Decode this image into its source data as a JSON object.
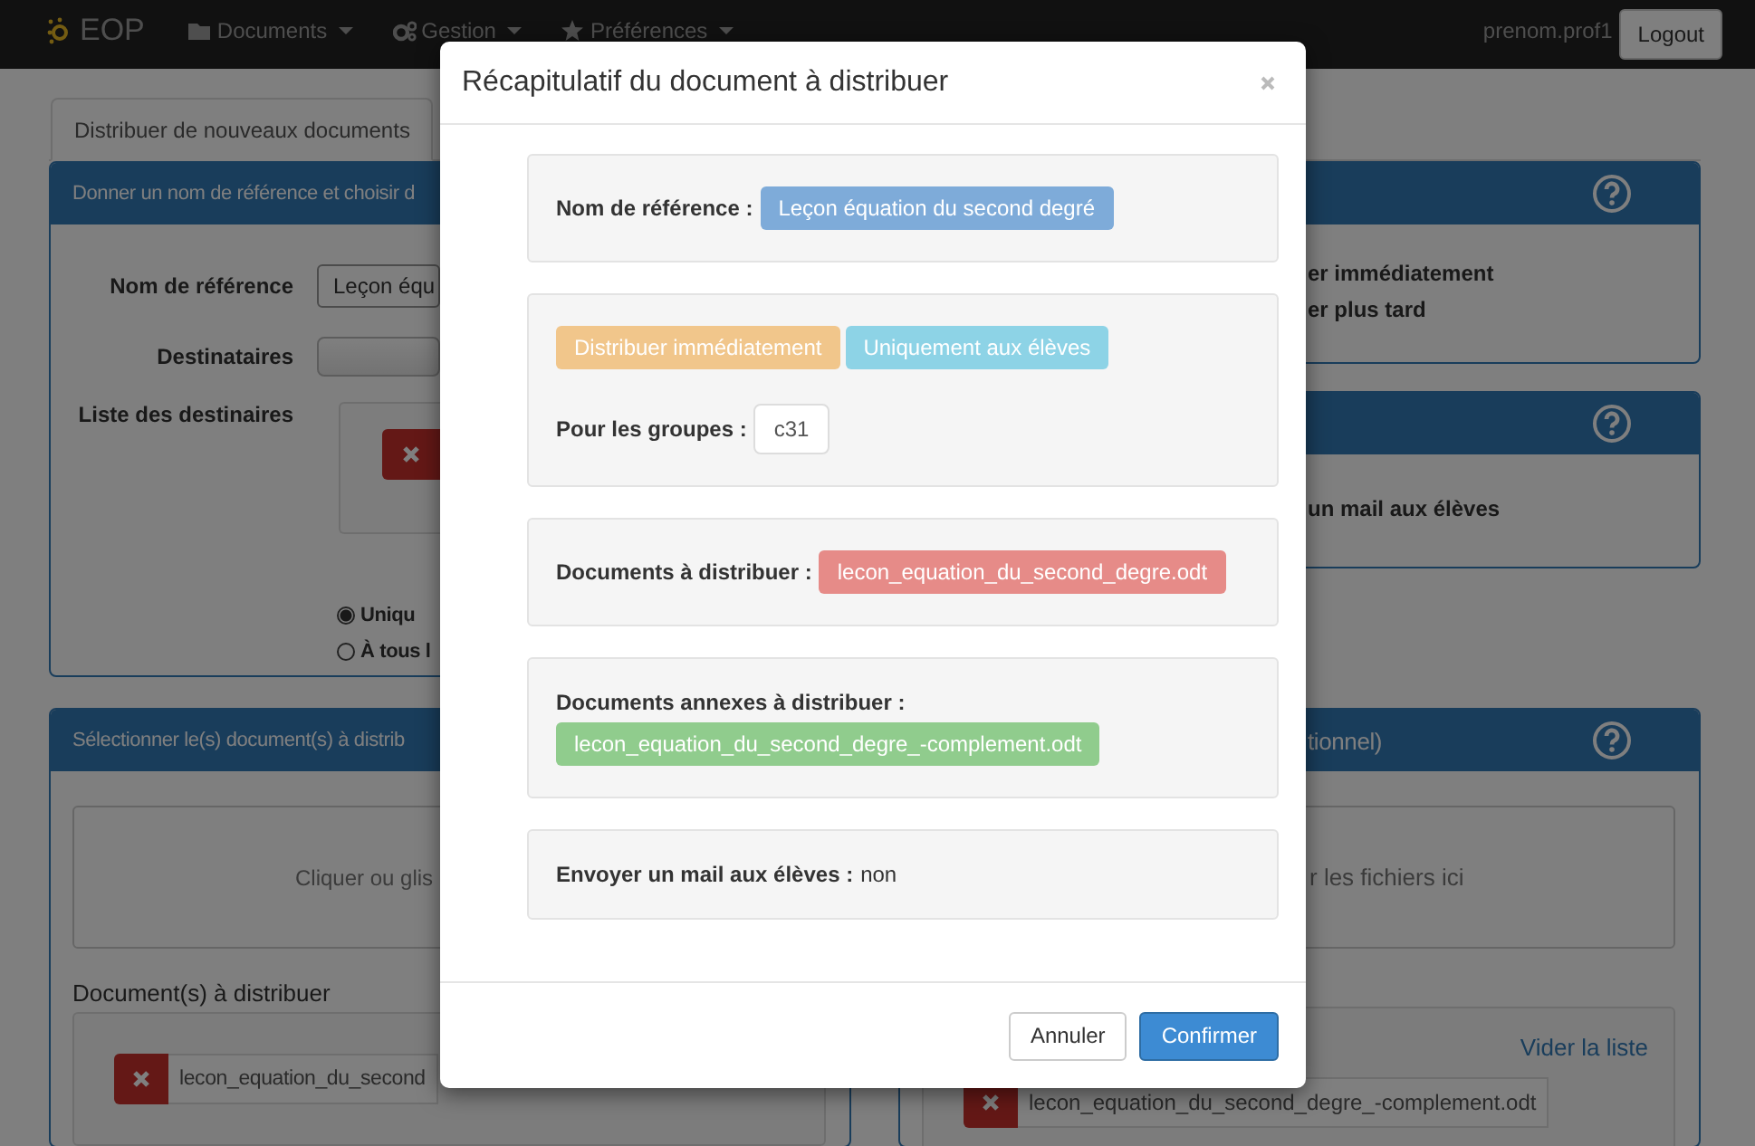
{
  "navbar": {
    "brand": "EOP",
    "menus": [
      {
        "label": "Documents"
      },
      {
        "label": "Gestion"
      },
      {
        "label": "Préférences"
      }
    ],
    "user": "prenom.prof1",
    "logout": "Logout"
  },
  "tabs": [
    {
      "label": "Distribuer de nouveaux documents",
      "selected": true
    }
  ],
  "name_panel": {
    "title": "Donner un nom de référence et choisir d",
    "reference_label": "Nom de référence",
    "reference_value": "Leçon équ",
    "recipients_label": "Destinataires",
    "recipient_list_label": "Liste des destinaires",
    "options": [
      {
        "label": "Uniqu",
        "selected": true
      },
      {
        "label": "À tous l",
        "selected": false
      }
    ]
  },
  "timing_panel": {
    "options": [
      "er immédiatement",
      "er plus tard"
    ]
  },
  "mail_panel": {
    "option": "un mail aux élèves"
  },
  "documents_panel": {
    "title": "Sélectionner le(s) document(s) à distrib",
    "dropzone": "Cliquer ou glis",
    "list_title": "Document(s) à distribuer",
    "files": [
      "lecon_equation_du_second"
    ]
  },
  "annex_panel": {
    "title": "tionnel)",
    "dropzone": "r les fichiers ici",
    "clear_link": "Vider la liste",
    "files": [
      "lecon_equation_du_second_degre_-complement.odt"
    ]
  },
  "modal": {
    "title": "Récapitulatif du document à distribuer",
    "reference": {
      "label": "Nom de référence :",
      "value": "Leçon équation du second degré"
    },
    "distribution": {
      "mode": "Distribuer immédiatement",
      "audience": "Uniquement aux élèves",
      "groups_label": "Pour les groupes :",
      "groups": [
        "c31"
      ]
    },
    "documents": {
      "label": "Documents à distribuer :",
      "files": [
        "lecon_equation_du_second_degre.odt"
      ]
    },
    "annexes": {
      "label": "Documents annexes à distribuer :",
      "files": [
        "lecon_equation_du_second_degre_-complement.odt"
      ]
    },
    "mail": {
      "label": "Envoyer un mail aux élèves :",
      "value": "non"
    },
    "buttons": [
      {
        "label": "Annuler",
        "kind": "default"
      },
      {
        "label": "Confirmer",
        "kind": "primary"
      }
    ]
  }
}
